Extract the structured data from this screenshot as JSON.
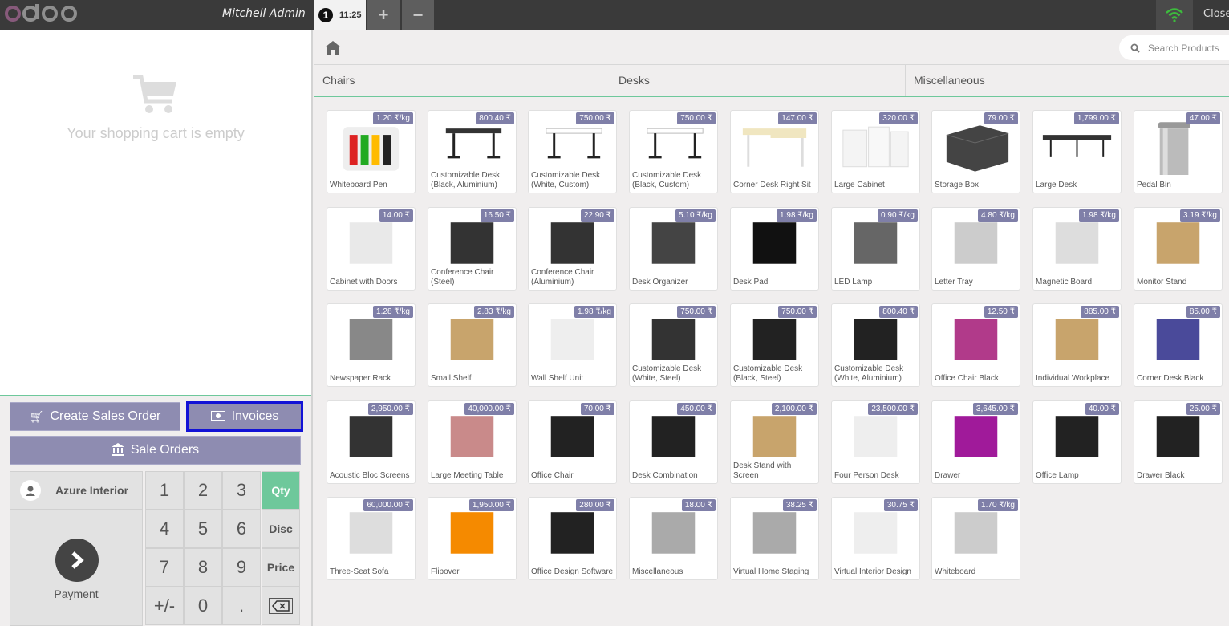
{
  "topbar": {
    "cashier": "Mitchell Admin",
    "order_number": "1",
    "order_time": "11:25",
    "add_order": "+",
    "remove_order": "−",
    "close": "Close"
  },
  "cart": {
    "empty_message": "Your shopping cart is empty"
  },
  "actions": {
    "create_sales_order": "Create Sales Order",
    "invoices": "Invoices",
    "sale_orders": "Sale Orders"
  },
  "customer": {
    "name": "Azure Interior"
  },
  "payment": {
    "label": "Payment"
  },
  "numpad": {
    "keys": [
      "1",
      "2",
      "3",
      "4",
      "5",
      "6",
      "7",
      "8",
      "9",
      "+/-",
      "0",
      "."
    ],
    "modes": [
      "Qty",
      "Disc",
      "Price"
    ],
    "active_mode": "Qty"
  },
  "search": {
    "placeholder": "Search Products"
  },
  "categories": [
    "Chairs",
    "Desks",
    "Miscellaneous"
  ],
  "products": [
    {
      "name": "Whiteboard Pen",
      "price": "1.20 ₹/kg"
    },
    {
      "name": "Customizable Desk (Black, Aluminium)",
      "price": "800.40 ₹"
    },
    {
      "name": "Customizable Desk (White, Custom)",
      "price": "750.00 ₹"
    },
    {
      "name": "Customizable Desk (Black, Custom)",
      "price": "750.00 ₹"
    },
    {
      "name": "Corner Desk Right Sit",
      "price": "147.00 ₹"
    },
    {
      "name": "Large Cabinet",
      "price": "320.00 ₹"
    },
    {
      "name": "Storage Box",
      "price": "79.00 ₹"
    },
    {
      "name": "Large Desk",
      "price": "1,799.00 ₹"
    },
    {
      "name": "Pedal Bin",
      "price": "47.00 ₹"
    },
    {
      "name": "Cabinet with Doors",
      "price": "14.00 ₹"
    },
    {
      "name": "Conference Chair (Steel)",
      "price": "16.50 ₹"
    },
    {
      "name": "Conference Chair (Aluminium)",
      "price": "22.90 ₹"
    },
    {
      "name": "Desk Organizer",
      "price": "5.10 ₹/kg"
    },
    {
      "name": "Desk Pad",
      "price": "1.98 ₹/kg"
    },
    {
      "name": "LED Lamp",
      "price": "0.90 ₹/kg"
    },
    {
      "name": "Letter Tray",
      "price": "4.80 ₹/kg"
    },
    {
      "name": "Magnetic Board",
      "price": "1.98 ₹/kg"
    },
    {
      "name": "Monitor Stand",
      "price": "3.19 ₹/kg"
    },
    {
      "name": "Newspaper Rack",
      "price": "1.28 ₹/kg"
    },
    {
      "name": "Small Shelf",
      "price": "2.83 ₹/kg"
    },
    {
      "name": "Wall Shelf Unit",
      "price": "1.98 ₹/kg"
    },
    {
      "name": "Customizable Desk (White, Steel)",
      "price": "750.00 ₹"
    },
    {
      "name": "Customizable Desk (Black, Steel)",
      "price": "750.00 ₹"
    },
    {
      "name": "Customizable Desk (White, Aluminium)",
      "price": "800.40 ₹"
    },
    {
      "name": "Office Chair Black",
      "price": "12.50 ₹"
    },
    {
      "name": "Individual Workplace",
      "price": "885.00 ₹"
    },
    {
      "name": "Corner Desk Black",
      "price": "85.00 ₹"
    },
    {
      "name": "Acoustic Bloc Screens",
      "price": "2,950.00 ₹"
    },
    {
      "name": "Large Meeting Table",
      "price": "40,000.00 ₹"
    },
    {
      "name": "Office Chair",
      "price": "70.00 ₹"
    },
    {
      "name": "Desk Combination",
      "price": "450.00 ₹"
    },
    {
      "name": "Desk Stand with Screen",
      "price": "2,100.00 ₹"
    },
    {
      "name": "Four Person Desk",
      "price": "23,500.00 ₹"
    },
    {
      "name": "Drawer",
      "price": "3,645.00 ₹"
    },
    {
      "name": "Office Lamp",
      "price": "40.00 ₹"
    },
    {
      "name": "Drawer Black",
      "price": "25.00 ₹"
    },
    {
      "name": "Three-Seat Sofa",
      "price": "60,000.00 ₹"
    },
    {
      "name": "Flipover",
      "price": "1,950.00 ₹"
    },
    {
      "name": "Office Design Software",
      "price": "280.00 ₹"
    },
    {
      "name": "Miscellaneous",
      "price": "18.00 ₹"
    },
    {
      "name": "Virtual Home Staging",
      "price": "38.25 ₹"
    },
    {
      "name": "Virtual Interior Design",
      "price": "30.75 ₹"
    },
    {
      "name": "Whiteboard",
      "price": "1.70 ₹/kg"
    }
  ]
}
